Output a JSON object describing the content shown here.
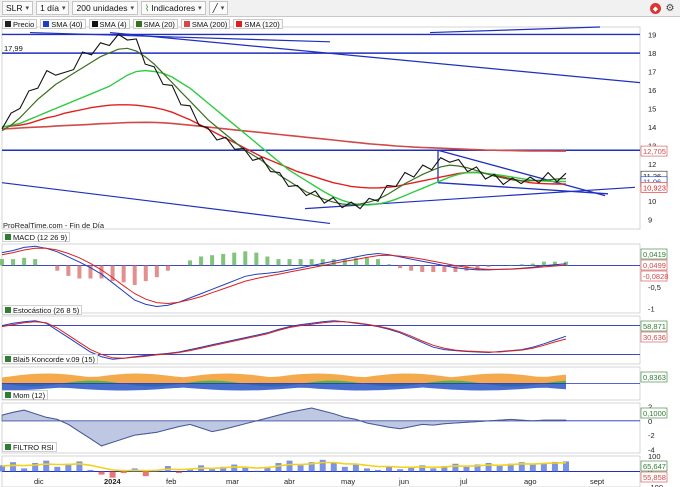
{
  "toolbar": {
    "symbol": "SLR",
    "interval": "1 día",
    "bars": "200 unidades",
    "indicators_label": "Indicadores"
  },
  "legend": [
    {
      "label": "Precio",
      "color": "#222222"
    },
    {
      "label": "SMA (40)",
      "color": "#1f3fbf"
    },
    {
      "label": "SMA (4)",
      "color": "#111111"
    },
    {
      "label": "SMA (20)",
      "color": "#3b6e1f"
    },
    {
      "label": "SMA (200)",
      "color": "#d04a4a"
    },
    {
      "label": "SMA (120)",
      "color": "#e0201e"
    }
  ],
  "source_text": "ProRealTime.com - Fin de Día",
  "top_value": "17,99",
  "panels": {
    "macd": "MACD (12 26 9)",
    "stoch": "Estocástico (26 8 5)",
    "koncorde": "Blai5 Koncorde v.09 (15)",
    "mom": "Mom (12)",
    "rsi": "FILTRO RSI"
  },
  "chart_data": {
    "type": "line",
    "x_labels": [
      "dic",
      "2024",
      "feb",
      "mar",
      "abr",
      "may",
      "jun",
      "jul",
      "ago",
      "sept"
    ],
    "price_axis": {
      "ticks": [
        19,
        18,
        17,
        16,
        15,
        14,
        13,
        12,
        11,
        10,
        9
      ],
      "ylim": [
        8.5,
        19.4
      ]
    },
    "price_tags": [
      {
        "value": "12,705",
        "color": "#d04a4a"
      },
      {
        "value": "11,26",
        "color": "#222222"
      },
      {
        "value": "11,06",
        "color": "#1f3fbf"
      },
      {
        "value": "10,923",
        "color": "#e0201e"
      }
    ],
    "price_series": [
      14.1,
      14.5,
      15.2,
      15.7,
      16.3,
      16.8,
      17.0,
      16.7,
      17.3,
      17.8,
      18.1,
      18.3,
      18.6,
      18.75,
      18.9,
      18.5,
      17.6,
      17.0,
      16.5,
      16.0,
      15.4,
      14.9,
      14.3,
      13.7,
      13.5,
      13.2,
      13.0,
      12.6,
      12.4,
      12.1,
      11.8,
      11.3,
      11.0,
      10.6,
      10.5,
      10.3,
      10.1,
      9.95,
      9.85,
      9.7,
      9.8,
      9.9,
      10.2,
      10.6,
      11.0,
      11.3,
      11.5,
      11.7,
      11.9,
      12.1,
      12.3,
      12.0,
      11.8,
      11.6,
      11.4,
      11.2,
      11.1,
      11.0,
      11.15,
      11.05,
      11.2,
      11.3,
      11.25,
      11.26
    ],
    "sma_20": [
      13.8,
      14.1,
      14.5,
      15.0,
      15.5,
      15.9,
      16.3,
      16.6,
      16.9,
      17.2,
      17.5,
      17.8,
      18.0,
      18.2,
      18.25,
      18.1,
      17.8,
      17.4,
      16.9,
      16.4,
      15.9,
      15.4,
      14.9,
      14.4,
      14.0,
      13.6,
      13.2,
      12.8,
      12.5,
      12.2,
      11.8,
      11.4,
      11.1,
      10.8,
      10.5,
      10.3,
      10.1,
      9.95,
      9.85,
      9.8,
      9.85,
      9.95,
      10.1,
      10.35,
      10.65,
      10.95,
      11.2,
      11.45,
      11.65,
      11.85,
      11.95,
      11.9,
      11.8,
      11.65,
      11.5,
      11.35,
      11.25,
      11.15,
      11.1,
      11.1,
      11.12,
      11.15,
      11.2,
      11.22
    ],
    "sma_40": [
      14.0,
      14.1,
      14.2,
      14.4,
      14.6,
      14.8,
      15.0,
      15.2,
      15.4,
      15.6,
      15.8,
      16.0,
      16.2,
      16.5,
      16.8,
      17.0,
      17.05,
      17.0,
      16.9,
      16.7,
      16.4,
      16.1,
      15.7,
      15.3,
      14.9,
      14.5,
      14.1,
      13.7,
      13.3,
      12.9,
      12.5,
      12.1,
      11.7,
      11.4,
      11.1,
      10.8,
      10.5,
      10.25,
      10.05,
      9.9,
      9.8,
      9.8,
      9.85,
      9.95,
      10.1,
      10.3,
      10.5,
      10.7,
      10.9,
      11.1,
      11.3,
      11.45,
      11.55,
      11.55,
      11.5,
      11.45,
      11.38,
      11.3,
      11.22,
      11.15,
      11.1,
      11.08,
      11.06,
      11.06
    ],
    "sma_120": [
      14.0,
      14.05,
      14.1,
      14.2,
      14.35,
      14.5,
      14.6,
      14.75,
      14.85,
      14.95,
      15.05,
      15.12,
      15.18,
      15.2,
      15.2,
      15.18,
      15.12,
      15.05,
      14.95,
      14.8,
      14.6,
      14.4,
      14.15,
      13.9,
      13.65,
      13.4,
      13.15,
      12.9,
      12.65,
      12.4,
      12.2,
      12.0,
      11.8,
      11.6,
      11.45,
      11.3,
      11.15,
      11.0,
      10.9,
      10.8,
      10.75,
      10.72,
      10.72,
      10.75,
      10.8,
      10.9,
      11.0,
      11.1,
      11.2,
      11.3,
      11.4,
      11.5,
      11.55,
      11.55,
      11.5,
      11.4,
      11.3,
      11.2,
      11.1,
      11.0,
      10.96,
      10.94,
      10.93,
      10.923
    ],
    "sma_200": [
      13.9,
      13.92,
      13.95,
      13.98,
      14.0,
      14.02,
      14.05,
      14.08,
      14.1,
      14.12,
      14.15,
      14.18,
      14.2,
      14.22,
      14.24,
      14.25,
      14.26,
      14.25,
      14.23,
      14.2,
      14.15,
      14.1,
      14.05,
      14.0,
      13.95,
      13.9,
      13.85,
      13.8,
      13.75,
      13.7,
      13.65,
      13.6,
      13.55,
      13.5,
      13.45,
      13.4,
      13.35,
      13.3,
      13.25,
      13.2,
      13.15,
      13.1,
      13.06,
      13.02,
      12.98,
      12.95,
      12.92,
      12.9,
      12.88,
      12.86,
      12.84,
      12.82,
      12.8,
      12.78,
      12.76,
      12.75,
      12.74,
      12.73,
      12.72,
      12.715,
      12.71,
      12.708,
      12.706,
      12.705
    ],
    "support_level": 12.75,
    "resistance_level": 17.99,
    "level_19": 19.0,
    "macd": {
      "ylim": [
        -1.1,
        0.5
      ],
      "ticks": [
        0,
        -0.5,
        -1
      ],
      "tags": [
        "0,0419",
        "0,0499",
        "-0,0828"
      ],
      "line": [
        0.3,
        0.35,
        0.42,
        0.45,
        0.4,
        0.32,
        0.2,
        0.08,
        -0.05,
        -0.2,
        -0.4,
        -0.6,
        -0.8,
        -0.9,
        -0.95,
        -0.92,
        -0.85,
        -0.75,
        -0.65,
        -0.55,
        -0.45,
        -0.35,
        -0.25,
        -0.2,
        -0.18,
        -0.15,
        -0.1,
        -0.05,
        0.0,
        0.05,
        0.1,
        0.15,
        0.2,
        0.25,
        0.28,
        0.25,
        0.2,
        0.15,
        0.1,
        0.05,
        0.0,
        -0.05,
        -0.08,
        -0.1,
        -0.1,
        -0.09,
        -0.08,
        -0.06,
        -0.04,
        0.0,
        0.02,
        0.04
      ],
      "signal": [
        0.25,
        0.3,
        0.36,
        0.4,
        0.4,
        0.36,
        0.28,
        0.18,
        0.05,
        -0.1,
        -0.28,
        -0.47,
        -0.65,
        -0.78,
        -0.86,
        -0.88,
        -0.85,
        -0.79,
        -0.72,
        -0.63,
        -0.54,
        -0.45,
        -0.36,
        -0.3,
        -0.25,
        -0.2,
        -0.15,
        -0.1,
        -0.05,
        0.0,
        0.05,
        0.1,
        0.14,
        0.19,
        0.23,
        0.24,
        0.22,
        0.19,
        0.15,
        0.1,
        0.05,
        0.0,
        -0.04,
        -0.07,
        -0.09,
        -0.09,
        -0.085,
        -0.07,
        -0.055,
        -0.03,
        -0.01,
        0.01
      ]
    },
    "stoch": {
      "ylim": [
        0,
        100
      ],
      "tags": [
        "58,871",
        "30,636"
      ],
      "k": [
        80,
        85,
        88,
        90,
        85,
        70,
        55,
        40,
        25,
        15,
        10,
        12,
        15,
        18,
        20,
        22,
        25,
        30,
        35,
        40,
        45,
        50,
        55,
        60,
        65,
        72,
        78,
        82,
        85,
        88,
        90,
        88,
        85,
        82,
        78,
        72,
        65,
        55,
        45,
        35,
        30,
        28,
        26,
        25,
        24,
        26,
        28,
        30,
        35,
        42,
        50,
        58
      ],
      "d": [
        78,
        82,
        86,
        88,
        86,
        75,
        60,
        45,
        30,
        20,
        13,
        12,
        14,
        16,
        19,
        21,
        24,
        28,
        33,
        38,
        43,
        48,
        53,
        58,
        63,
        70,
        76,
        80,
        83,
        86,
        88,
        88,
        86,
        83,
        79,
        74,
        67,
        58,
        48,
        39,
        33,
        29,
        27,
        26,
        25,
        25,
        27,
        29,
        33,
        39,
        46,
        52
      ]
    },
    "mom": {
      "ylim": [
        -4.5,
        2.5
      ],
      "ticks": [
        2,
        0,
        -2,
        -4
      ],
      "tags": [
        "0,1000"
      ],
      "values": [
        0.8,
        1.2,
        1.5,
        1.0,
        0.5,
        0.2,
        -0.5,
        -1.5,
        -2.5,
        -3.5,
        -3.0,
        -2.5,
        -2.0,
        -1.8,
        -1.6,
        -1.2,
        -0.8,
        -0.5,
        -1.0,
        -1.5,
        -1.2,
        -0.8,
        -0.4,
        0.0,
        0.4,
        0.8,
        1.2,
        1.5,
        1.8,
        1.4,
        1.0,
        0.5,
        0.2,
        -0.3,
        -0.6,
        -0.9,
        -1.1,
        -0.8,
        -0.5,
        -0.6,
        -0.4,
        -0.3,
        -0.2,
        -0.1,
        0.0,
        0.1,
        0.2,
        0.1,
        0.0,
        0.1,
        0.1,
        0.1
      ]
    },
    "rsi": {
      "ylim": [
        -100,
        100
      ],
      "ticks": [
        100,
        0,
        -100
      ],
      "tags": [
        "65,647",
        "55,858"
      ],
      "values": [
        40,
        60,
        20,
        55,
        70,
        30,
        50,
        65,
        10,
        -20,
        -40,
        -10,
        20,
        -30,
        10,
        35,
        -10,
        20,
        40,
        15,
        30,
        45,
        25,
        5,
        30,
        55,
        70,
        40,
        60,
        75,
        55,
        30,
        45,
        20,
        10,
        35,
        15,
        25,
        40,
        20,
        35,
        50,
        30,
        45,
        55,
        40,
        50,
        60,
        45,
        55,
        62,
        65
      ],
      "smooth": [
        35,
        40,
        38,
        42,
        48,
        45,
        46,
        50,
        40,
        25,
        10,
        5,
        8,
        5,
        8,
        15,
        12,
        15,
        22,
        20,
        24,
        30,
        28,
        22,
        25,
        35,
        45,
        45,
        50,
        58,
        58,
        50,
        48,
        40,
        32,
        32,
        28,
        27,
        30,
        27,
        30,
        36,
        34,
        37,
        42,
        40,
        44,
        50,
        48,
        52,
        55,
        56
      ]
    }
  }
}
